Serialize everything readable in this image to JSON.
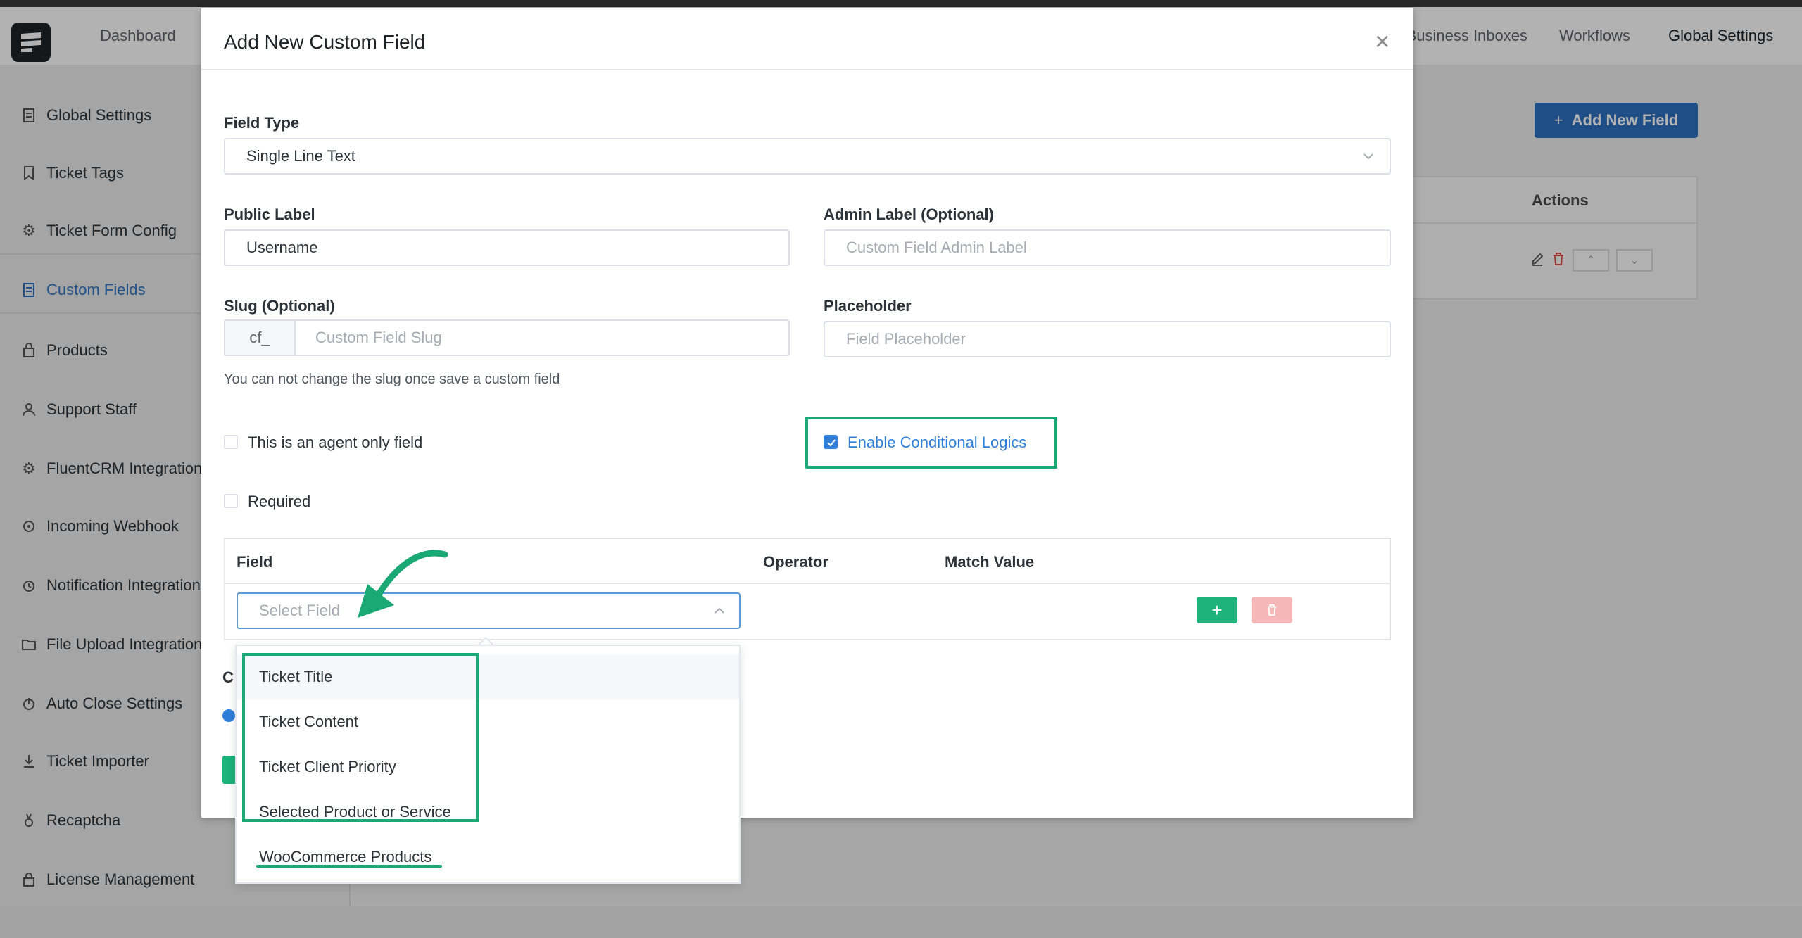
{
  "topnav": {
    "items": [
      "Dashboard",
      "Business Inboxes",
      "Workflows",
      "Global Settings"
    ],
    "active": "Global Settings"
  },
  "sidebar": {
    "items": [
      {
        "label": "Global Settings",
        "icon": "document-icon"
      },
      {
        "label": "Ticket Tags",
        "icon": "bookmark-icon"
      },
      {
        "label": "Ticket Form Config",
        "icon": "gear-icon"
      },
      {
        "label": "Custom Fields",
        "icon": "document-icon",
        "active": true
      },
      {
        "label": "Products",
        "icon": "bag-icon"
      },
      {
        "label": "Support Staff",
        "icon": "user-icon"
      },
      {
        "label": "FluentCRM Integration",
        "icon": "gear-icon"
      },
      {
        "label": "Incoming Webhook",
        "icon": "webhook-icon"
      },
      {
        "label": "Notification Integrations",
        "icon": "alarm-icon"
      },
      {
        "label": "File Upload Integrations",
        "icon": "folder-icon"
      },
      {
        "label": "Auto Close Settings",
        "icon": "power-icon"
      },
      {
        "label": "Ticket Importer",
        "icon": "download-icon"
      },
      {
        "label": "Recaptcha",
        "icon": "recaptcha-icon"
      },
      {
        "label": "License Management",
        "icon": "lock-icon"
      }
    ]
  },
  "main": {
    "add_new_field": "Add New Field",
    "actions_header": "Actions"
  },
  "modal": {
    "title": "Add New Custom Field",
    "field_type": {
      "label": "Field Type",
      "value": "Single Line Text"
    },
    "public_label": {
      "label": "Public Label",
      "value": "Username"
    },
    "admin_label": {
      "label": "Admin Label (Optional)",
      "placeholder": "Custom Field Admin Label"
    },
    "slug": {
      "label": "Slug (Optional)",
      "prefix": "cf_",
      "placeholder": "Custom Field Slug",
      "help": "You can not change the slug once save a custom field"
    },
    "placeholder": {
      "label": "Placeholder",
      "placeholder": "Field Placeholder"
    },
    "agent_only": {
      "label": "This is an agent only field",
      "checked": false
    },
    "required": {
      "label": "Required",
      "checked": false
    },
    "conditional": {
      "label": "Enable Conditional Logics",
      "checked": true
    },
    "conditions_table": {
      "headers": [
        "Field",
        "Operator",
        "Match Value"
      ],
      "select_placeholder": "Select Field"
    },
    "dropdown_options": [
      "Ticket Title",
      "Ticket Content",
      "Ticket Client Priority",
      "Selected Product or Service",
      "WooCommerce Products"
    ],
    "peek_letter": "C"
  },
  "colors": {
    "accent_blue": "#2f7fd8",
    "highlight_green": "#1aa877",
    "add_button_green": "#1db37a",
    "delete_button_pink": "#f5b7b7"
  }
}
